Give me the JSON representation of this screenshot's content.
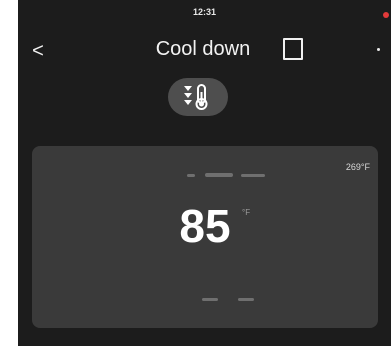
{
  "status": {
    "time": "12:31"
  },
  "header": {
    "back_symbol": "<",
    "title": "Cool down",
    "door_icon": "door-icon"
  },
  "mode": {
    "icon": "cool-down-thermometer-icon"
  },
  "temperature_card": {
    "probe_temp": "269°F",
    "value": "85",
    "unit": "°F"
  },
  "colors": {
    "background": "#1c1c1c",
    "card": "#3a3a3a",
    "mode_pill": "#4e4e4e",
    "status_dot": "#e23a3a"
  }
}
